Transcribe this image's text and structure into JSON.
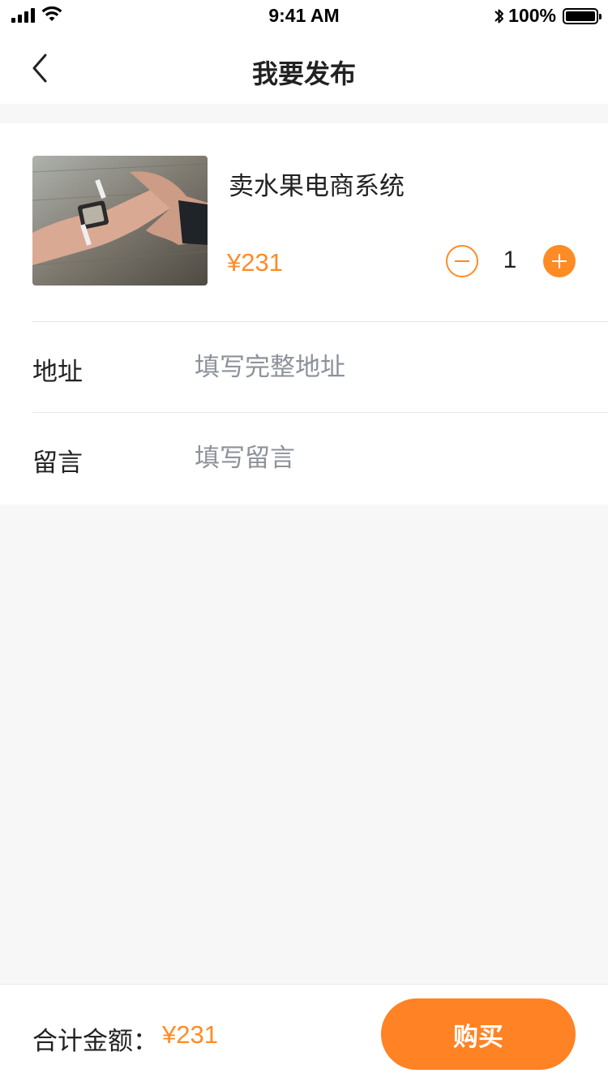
{
  "status_bar": {
    "time": "9:41 AM",
    "battery": "100%",
    "icons": [
      "signal-icon",
      "wifi-icon",
      "bluetooth-icon",
      "battery-icon"
    ]
  },
  "nav": {
    "title": "我要发布",
    "back_icon": "chevron-left-icon"
  },
  "product": {
    "name": "卖水果电商系统",
    "price": "¥231",
    "quantity": "1",
    "image": "wrist-smartwatch-photo"
  },
  "form": {
    "address": {
      "label": "地址",
      "placeholder": "填写完整地址"
    },
    "message": {
      "label": "留言",
      "placeholder": "填写留言"
    }
  },
  "footer": {
    "total_label": "合计金额：",
    "total_value": "¥231",
    "buy_label": "购买"
  },
  "colors": {
    "accent": "#ff8b25",
    "button": "#ff8224",
    "placeholder": "#8d929a",
    "background": "#f7f7f7"
  }
}
